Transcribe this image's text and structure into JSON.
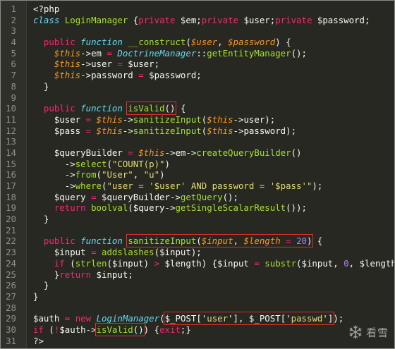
{
  "editor": {
    "theme_colors": {
      "background": "#272822",
      "gutter": "#2f302a",
      "line_number": "#8f908a",
      "keyword": "#f92672",
      "type": "#66d9ef",
      "function": "#a6e22e",
      "variable": "#fd971f",
      "string": "#e6db74",
      "number": "#ae81ff",
      "highlight_box": "#e0312a"
    },
    "lines": [
      {
        "n": "1",
        "tokens": [
          [
            "plain",
            "<?php"
          ]
        ]
      },
      {
        "n": "2",
        "tokens": [
          [
            "type",
            "class"
          ],
          [
            "plain",
            " "
          ],
          [
            "classdef",
            "LoginManager"
          ],
          [
            "plain",
            " {"
          ],
          [
            "kw",
            "private"
          ],
          [
            "plain",
            " $em;"
          ],
          [
            "kw",
            "private"
          ],
          [
            "plain",
            " $user;"
          ],
          [
            "kw",
            "private"
          ],
          [
            "plain",
            " $password;"
          ]
        ]
      },
      {
        "n": "3",
        "tokens": []
      },
      {
        "n": "4",
        "tokens": [
          [
            "plain",
            "  "
          ],
          [
            "kw",
            "public"
          ],
          [
            "plain",
            " "
          ],
          [
            "type",
            "function"
          ],
          [
            "plain",
            " "
          ],
          [
            "func",
            "__construct"
          ],
          [
            "plain",
            "("
          ],
          [
            "var",
            "$user"
          ],
          [
            "plain",
            ", "
          ],
          [
            "var",
            "$password"
          ],
          [
            "plain",
            ") {"
          ]
        ]
      },
      {
        "n": "5",
        "tokens": [
          [
            "plain",
            "    "
          ],
          [
            "this",
            "$this"
          ],
          [
            "plain",
            "->em "
          ],
          [
            "kw",
            "="
          ],
          [
            "plain",
            " "
          ],
          [
            "type",
            "DoctrineManager"
          ],
          [
            "plain",
            "::"
          ],
          [
            "func",
            "getEntityManager"
          ],
          [
            "plain",
            "();"
          ]
        ]
      },
      {
        "n": "6",
        "tokens": [
          [
            "plain",
            "    "
          ],
          [
            "this",
            "$this"
          ],
          [
            "plain",
            "->user "
          ],
          [
            "kw",
            "="
          ],
          [
            "plain",
            " $user;"
          ]
        ]
      },
      {
        "n": "7",
        "tokens": [
          [
            "plain",
            "    "
          ],
          [
            "this",
            "$this"
          ],
          [
            "plain",
            "->password "
          ],
          [
            "kw",
            "="
          ],
          [
            "plain",
            " $password;"
          ]
        ]
      },
      {
        "n": "8",
        "tokens": [
          [
            "plain",
            "  }"
          ]
        ]
      },
      {
        "n": "9",
        "tokens": []
      },
      {
        "n": "10",
        "tokens": [
          [
            "plain",
            "  "
          ],
          [
            "kw",
            "public"
          ],
          [
            "plain",
            " "
          ],
          [
            "type",
            "function"
          ],
          [
            "plain",
            " "
          ],
          [
            "func",
            "isValid",
            "hl"
          ],
          [
            "plain",
            "()",
            "hl"
          ],
          [
            "plain",
            " {"
          ]
        ]
      },
      {
        "n": "11",
        "tokens": [
          [
            "plain",
            "    $user "
          ],
          [
            "kw",
            "="
          ],
          [
            "plain",
            " "
          ],
          [
            "this",
            "$this"
          ],
          [
            "plain",
            "->"
          ],
          [
            "func",
            "sanitizeInput"
          ],
          [
            "plain",
            "("
          ],
          [
            "this",
            "$this"
          ],
          [
            "plain",
            "->user);"
          ]
        ]
      },
      {
        "n": "12",
        "tokens": [
          [
            "plain",
            "    $pass "
          ],
          [
            "kw",
            "="
          ],
          [
            "plain",
            " "
          ],
          [
            "this",
            "$this"
          ],
          [
            "plain",
            "->"
          ],
          [
            "func",
            "sanitizeInput"
          ],
          [
            "plain",
            "("
          ],
          [
            "this",
            "$this"
          ],
          [
            "plain",
            "->password);"
          ]
        ]
      },
      {
        "n": "13",
        "tokens": []
      },
      {
        "n": "14",
        "tokens": [
          [
            "plain",
            "    $queryBuilder "
          ],
          [
            "kw",
            "="
          ],
          [
            "plain",
            " "
          ],
          [
            "this",
            "$this"
          ],
          [
            "plain",
            "->em->"
          ],
          [
            "func",
            "createQueryBuilder"
          ],
          [
            "plain",
            "()"
          ]
        ]
      },
      {
        "n": "15",
        "tokens": [
          [
            "plain",
            "      ->"
          ],
          [
            "func",
            "select"
          ],
          [
            "plain",
            "("
          ],
          [
            "str",
            "\"COUNT(p)\""
          ],
          [
            "plain",
            ")"
          ]
        ]
      },
      {
        "n": "16",
        "tokens": [
          [
            "plain",
            "      ->"
          ],
          [
            "func",
            "from"
          ],
          [
            "plain",
            "("
          ],
          [
            "str",
            "\"User\""
          ],
          [
            "plain",
            ", "
          ],
          [
            "str",
            "\"u\""
          ],
          [
            "plain",
            ")"
          ]
        ]
      },
      {
        "n": "17",
        "tokens": [
          [
            "plain",
            "      ->"
          ],
          [
            "func",
            "where"
          ],
          [
            "plain",
            "("
          ],
          [
            "str",
            "\"user = '$user' AND password = '$pass'\""
          ],
          [
            "plain",
            ");"
          ]
        ]
      },
      {
        "n": "18",
        "tokens": [
          [
            "plain",
            "    $query "
          ],
          [
            "kw",
            "="
          ],
          [
            "plain",
            " $queryBuilder->"
          ],
          [
            "func",
            "getQuery"
          ],
          [
            "plain",
            "();"
          ]
        ]
      },
      {
        "n": "19",
        "tokens": [
          [
            "plain",
            "    "
          ],
          [
            "kw",
            "return"
          ],
          [
            "plain",
            " "
          ],
          [
            "func",
            "boolval"
          ],
          [
            "plain",
            "($query->"
          ],
          [
            "func",
            "getSingleScalarResult"
          ],
          [
            "plain",
            "());"
          ]
        ]
      },
      {
        "n": "20",
        "tokens": [
          [
            "plain",
            "  }"
          ]
        ]
      },
      {
        "n": "21",
        "tokens": []
      },
      {
        "n": "22",
        "tokens": [
          [
            "plain",
            "  "
          ],
          [
            "kw",
            "public"
          ],
          [
            "plain",
            " "
          ],
          [
            "type",
            "function"
          ],
          [
            "plain",
            " "
          ],
          [
            "func",
            "sanitizeInput",
            "hl"
          ],
          [
            "plain",
            "(",
            "hl"
          ],
          [
            "var",
            "$input",
            "hl"
          ],
          [
            "plain",
            ", ",
            "hl"
          ],
          [
            "var",
            "$length",
            "hl"
          ],
          [
            "plain",
            " ",
            "hl"
          ],
          [
            "kw",
            "=",
            "hl"
          ],
          [
            "plain",
            " ",
            "hl"
          ],
          [
            "num",
            "20",
            "hl"
          ],
          [
            "plain",
            ")",
            "hl"
          ],
          [
            "plain",
            " {"
          ]
        ]
      },
      {
        "n": "23",
        "tokens": [
          [
            "plain",
            "    $input "
          ],
          [
            "kw",
            "="
          ],
          [
            "plain",
            " "
          ],
          [
            "func",
            "addslashes"
          ],
          [
            "plain",
            "($input);"
          ]
        ]
      },
      {
        "n": "24",
        "tokens": [
          [
            "plain",
            "    "
          ],
          [
            "kw",
            "if"
          ],
          [
            "plain",
            " ("
          ],
          [
            "func",
            "strlen"
          ],
          [
            "plain",
            "($input) "
          ],
          [
            "kw",
            ">"
          ],
          [
            "plain",
            " $length) {$input "
          ],
          [
            "kw",
            "="
          ],
          [
            "plain",
            " "
          ],
          [
            "func",
            "substr"
          ],
          [
            "plain",
            "($input, "
          ],
          [
            "num",
            "0"
          ],
          [
            "plain",
            ", $length);"
          ]
        ]
      },
      {
        "n": "25",
        "tokens": [
          [
            "plain",
            "    }"
          ],
          [
            "kw",
            "return"
          ],
          [
            "plain",
            " $input;"
          ]
        ]
      },
      {
        "n": "26",
        "tokens": [
          [
            "plain",
            "  }"
          ]
        ]
      },
      {
        "n": "27",
        "tokens": [
          [
            "plain",
            "}"
          ]
        ]
      },
      {
        "n": "28",
        "tokens": []
      },
      {
        "n": "29",
        "tokens": [
          [
            "plain",
            "$auth "
          ],
          [
            "kw",
            "="
          ],
          [
            "plain",
            " "
          ],
          [
            "kw",
            "new"
          ],
          [
            "plain",
            " "
          ],
          [
            "type",
            "LoginManager"
          ],
          [
            "plain",
            "("
          ],
          [
            "plain",
            "$_POST['",
            "hl"
          ],
          [
            "str",
            "user",
            "hl"
          ],
          [
            "plain",
            "'], $_POST['",
            "hl"
          ],
          [
            "str",
            "passwd",
            "hl"
          ],
          [
            "plain",
            "']",
            "hl"
          ],
          [
            "plain",
            ");"
          ]
        ]
      },
      {
        "n": "30",
        "tokens": [
          [
            "kw",
            "if"
          ],
          [
            "plain",
            " ("
          ],
          [
            "kw",
            "!"
          ],
          [
            "plain",
            "$auth->"
          ],
          [
            "func",
            "isValid",
            "hl"
          ],
          [
            "plain",
            "()",
            "hl"
          ],
          [
            "plain",
            ") {"
          ],
          [
            "kw",
            "exit"
          ],
          [
            "plain",
            ";}"
          ]
        ]
      },
      {
        "n": "31",
        "tokens": [
          [
            "plain",
            "?>"
          ]
        ]
      }
    ]
  },
  "watermark": {
    "icon": "snowflake-icon",
    "text": "看雪"
  }
}
